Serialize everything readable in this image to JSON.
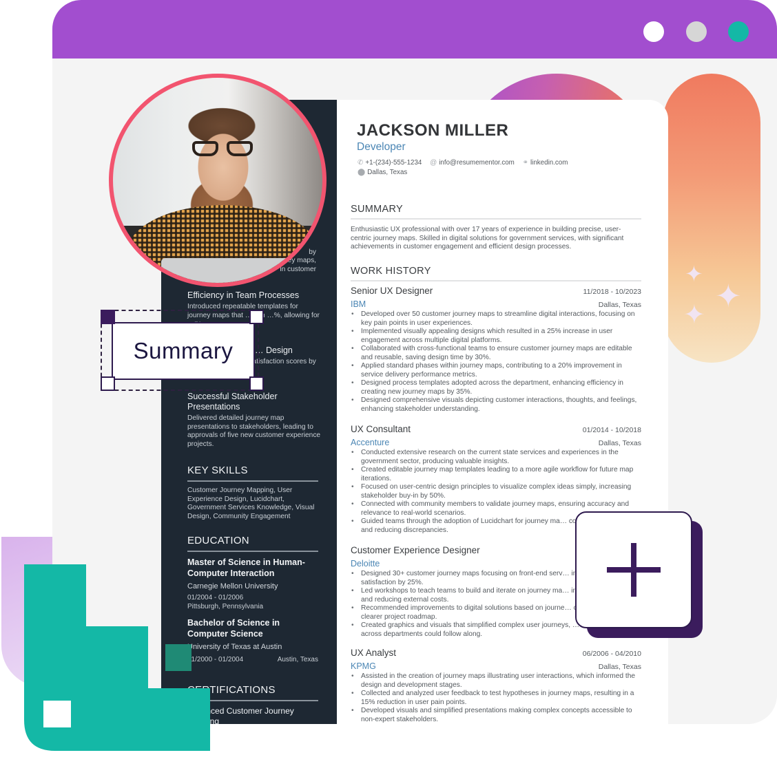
{
  "window": {
    "header_color": "#a24ecf",
    "controls": [
      {
        "name": "white-dot",
        "color": "#ffffff"
      },
      {
        "name": "gray-dot",
        "color": "#d6d6d6"
      },
      {
        "name": "teal-dot",
        "color": "#14b8a6"
      }
    ]
  },
  "resume": {
    "name": "JACKSON MILLER",
    "role": "Developer",
    "contact": {
      "phone": "+1-(234)-555-1234",
      "email": "info@resumementor.com",
      "website": "linkedin.com",
      "location": "Dallas, Texas",
      "icons": {
        "phone": "phone-icon",
        "email": "at-icon",
        "website": "link-icon",
        "location": "map-pin-icon"
      }
    },
    "summary": {
      "heading": "SUMMARY",
      "text": "Enthusiastic UX professional with over 17 years of experience in building precise, user-centric journey maps. Skilled in digital solutions for government services, with significant achievements in customer engagement and efficient design processes."
    },
    "work_history": {
      "heading": "WORK HISTORY",
      "jobs": [
        {
          "title": "Senior UX Designer",
          "dates": "11/2018 - 10/2023",
          "company": "IBM",
          "location": "Dallas, Texas",
          "bullets": [
            "Developed over 50 customer journey maps to streamline digital interactions, focusing on key pain points in user experiences.",
            "Implemented visually appealing designs which resulted in a 25% increase in user engagement across multiple digital platforms.",
            "Collaborated with cross-functional teams to ensure customer journey maps are editable and reusable, saving design time by 30%.",
            "Applied standard phases within journey maps, contributing to a 20% improvement in service delivery performance metrics.",
            "Designed process templates adopted across the department, enhancing efficiency in creating new journey maps by 35%.",
            "Designed comprehensive visuals depicting customer interactions, thoughts, and feelings, enhancing stakeholder understanding."
          ]
        },
        {
          "title": "UX Consultant",
          "dates": "01/2014 - 10/2018",
          "company": "Accenture",
          "location": "Dallas, Texas",
          "bullets": [
            "Conducted extensive research on the current state services and experiences in the government sector, producing valuable insights.",
            "Created editable journey map templates leading to a more agile workflow for future map iterations.",
            "Focused on user-centric design principles to visualize complex ideas simply, increasing stakeholder buy-in by 50%.",
            "Connected with community members to validate journey maps, ensuring accuracy and relevance to real-world scenarios.",
            "Guided teams through the adoption of Lucidchart for journey ma… collaborative efforts and reducing discrepancies."
          ]
        },
        {
          "title": "Customer Experience Designer",
          "dates": "",
          "company": "Deloitte",
          "location": "",
          "bullets": [
            "Designed 30+ customer journey maps focusing on front-end serv… increasing user satisfaction by 25%.",
            "Led workshops to teach teams to build and iterate on journey ma… internal capabilities and reducing external costs.",
            "Recommended improvements to digital solutions based on journe… contributing to a clearer project roadmap.",
            "Created graphics and visuals that simplified complex user journeys, … stakeholders across departments could follow along."
          ]
        },
        {
          "title": "UX Analyst",
          "dates": "06/2006 - 04/2010",
          "company": "KPMG",
          "location": "Dallas, Texas",
          "bullets": [
            "Assisted in the creation of journey maps illustrating user interactions, which informed the design and development stages.",
            "Collected and analyzed user feedback to test hypotheses in journey maps, resulting in a 15% reduction in user pain points.",
            "Developed visuals and simplified presentations making complex concepts accessible to non-expert stakeholders."
          ]
        }
      ]
    },
    "sidebar": {
      "partial_top_lines": [
        "by",
        "ey maps,",
        "in customer"
      ],
      "accomplishments": [
        {
          "title": "Efficiency in Team Processes",
          "desc": "Introduced repeatable templates for journey maps that …own …%, allowing for …ry."
        },
        {
          "title": "… Design",
          "desc": "…gn digital … user satisfaction scores by 40% ove… quarters."
        },
        {
          "title": "Successful Stakeholder Presentations",
          "desc": "Delivered detailed journey map presentations to stakeholders, leading to approvals of five new customer experience projects."
        }
      ],
      "skills": {
        "heading": "KEY SKILLS",
        "text": "Customer Journey Mapping, User Experience Design, Lucidchart, Government Services Knowledge, Visual Design, Community Engagement"
      },
      "education": {
        "heading": "EDUCATION",
        "entries": [
          {
            "degree": "Master of Science in Human-Computer Interaction",
            "school": "Carnegie Mellon University",
            "dates": "01/2004 - 01/2006",
            "location": "Pittsburgh, Pennsylvania"
          },
          {
            "degree": "Bachelor of Science in Computer Science",
            "school": "University of Texas at Austin",
            "dates": "01/2000 - 01/2004",
            "location": "Austin, Texas"
          }
        ]
      },
      "certifications": {
        "heading": "CERTIFICATIONS",
        "items": [
          "Advanced Customer Journey Mapping"
        ]
      }
    }
  },
  "overlay": {
    "section_tag": "Summary",
    "add_button_icon": "plus-icon"
  },
  "colors": {
    "accent_purple": "#a24ecf",
    "dark_purple": "#3b1c5d",
    "photo_ring": "#f2546f",
    "teal": "#14b8a6",
    "sidebar_bg": "#1e2833",
    "company_blue": "#4b86b4"
  }
}
